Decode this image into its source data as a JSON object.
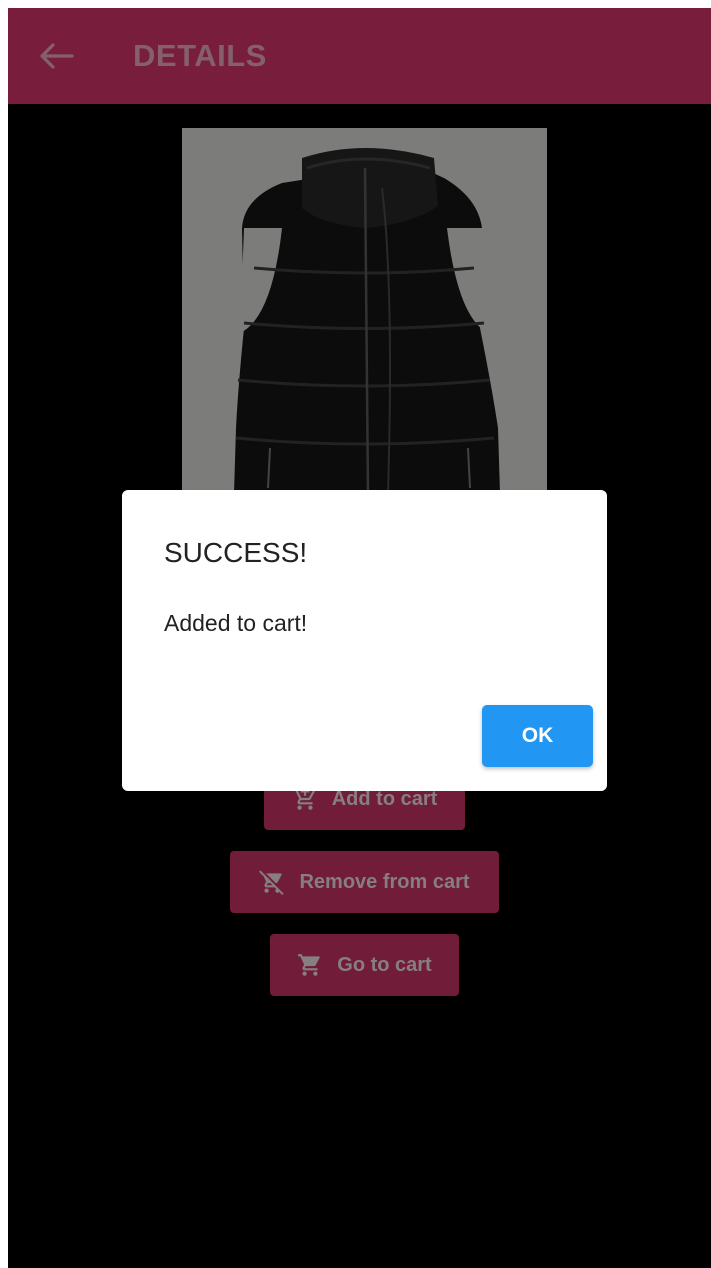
{
  "app_bar": {
    "title": "DETAILS",
    "back_icon": "arrow-left-icon",
    "background_color": "#781e3c"
  },
  "product": {
    "image": "black-puffer-vest"
  },
  "actions": {
    "add_to_cart": {
      "label": "Add to cart",
      "icon": "add-shopping-cart-icon"
    },
    "remove_from_cart": {
      "label": "Remove from cart",
      "icon": "remove-shopping-cart-icon"
    },
    "go_to_cart": {
      "label": "Go to cart",
      "icon": "shopping-cart-icon"
    },
    "button_color": "#711c38"
  },
  "dialog": {
    "title": "SUCCESS!",
    "message": "Added to cart!",
    "ok_label": "OK",
    "ok_color": "#2196f3"
  }
}
